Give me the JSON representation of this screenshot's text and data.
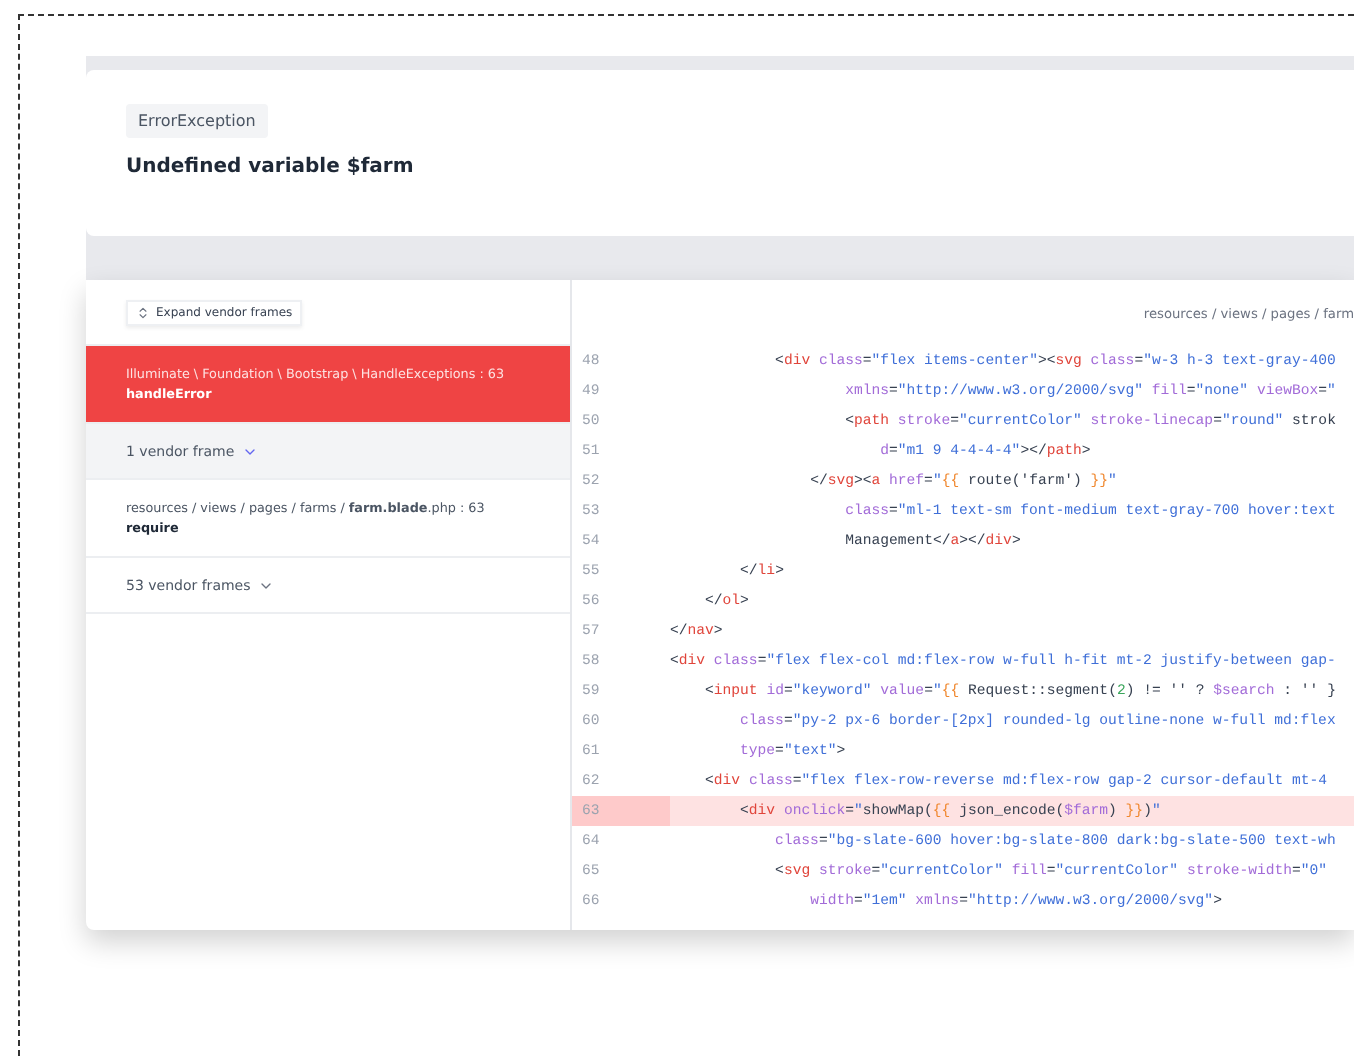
{
  "exception": {
    "type": "ErrorException",
    "message": "Undefined variable $farm"
  },
  "sidebar": {
    "expand_button": "Expand vendor frames",
    "frames": [
      {
        "kind": "frame",
        "selected": true,
        "path": "Illuminate \\ Foundation \\ Bootstrap \\ HandleExceptions : 63",
        "method": "handleError"
      },
      {
        "kind": "vendor",
        "highlighted": true,
        "label": "1 vendor frame"
      },
      {
        "kind": "frame",
        "selected": false,
        "path": "resources / views / pages / farms / **farm.blade**.php : 63",
        "method": "require"
      },
      {
        "kind": "vendor",
        "highlighted": false,
        "label": "53 vendor frames"
      }
    ]
  },
  "code": {
    "file": "resources / views / pages / farm",
    "lines": [
      {
        "number": "48",
        "highlighted": false,
        "text": "            <div class=\"flex items-center\"><svg class=\"w-3 h-3 text-gray-400"
      },
      {
        "number": "49",
        "highlighted": false,
        "text": "                    xmlns=\"http://www.w3.org/2000/svg\" fill=\"none\" viewBox=\""
      },
      {
        "number": "50",
        "highlighted": false,
        "text": "                    <path stroke=\"currentColor\" stroke-linecap=\"round\" strok"
      },
      {
        "number": "51",
        "highlighted": false,
        "text": "                        d=\"m1 9 4-4-4-4\"></path>"
      },
      {
        "number": "52",
        "highlighted": false,
        "text": "                </svg><a href=\"{{ route('farm') }}\""
      },
      {
        "number": "53",
        "highlighted": false,
        "text": "                    class=\"ml-1 text-sm font-medium text-gray-700 hover:text"
      },
      {
        "number": "54",
        "highlighted": false,
        "text": "                    Management</a></div>"
      },
      {
        "number": "55",
        "highlighted": false,
        "text": "        </li>"
      },
      {
        "number": "56",
        "highlighted": false,
        "text": "    </ol>"
      },
      {
        "number": "57",
        "highlighted": false,
        "text": "</nav>"
      },
      {
        "number": "58",
        "highlighted": false,
        "text": "<div class=\"flex flex-col md:flex-row w-full h-fit mt-2 justify-between gap-"
      },
      {
        "number": "59",
        "highlighted": false,
        "text": "    <input id=\"keyword\" value=\"{{ Request::segment(2) != '' ? $search : '' }"
      },
      {
        "number": "60",
        "highlighted": false,
        "text": "        class=\"py-2 px-6 border-[2px] rounded-lg outline-none w-full md:flex"
      },
      {
        "number": "61",
        "highlighted": false,
        "text": "        type=\"text\">"
      },
      {
        "number": "62",
        "highlighted": false,
        "text": "    <div class=\"flex flex-row-reverse md:flex-row gap-2 cursor-default mt-4"
      },
      {
        "number": "63",
        "highlighted": true,
        "text": "        <div onclick=\"showMap({{ json_encode($farm) }})\""
      },
      {
        "number": "64",
        "highlighted": false,
        "text": "            class=\"bg-slate-600 hover:bg-slate-800 dark:bg-slate-500 text-wh"
      },
      {
        "number": "65",
        "highlighted": false,
        "text": "            <svg stroke=\"currentColor\" fill=\"currentColor\" stroke-width=\"0\""
      },
      {
        "number": "66",
        "highlighted": false,
        "text": "                width=\"1em\" xmlns=\"http://www.w3.org/2000/svg\">"
      }
    ]
  }
}
